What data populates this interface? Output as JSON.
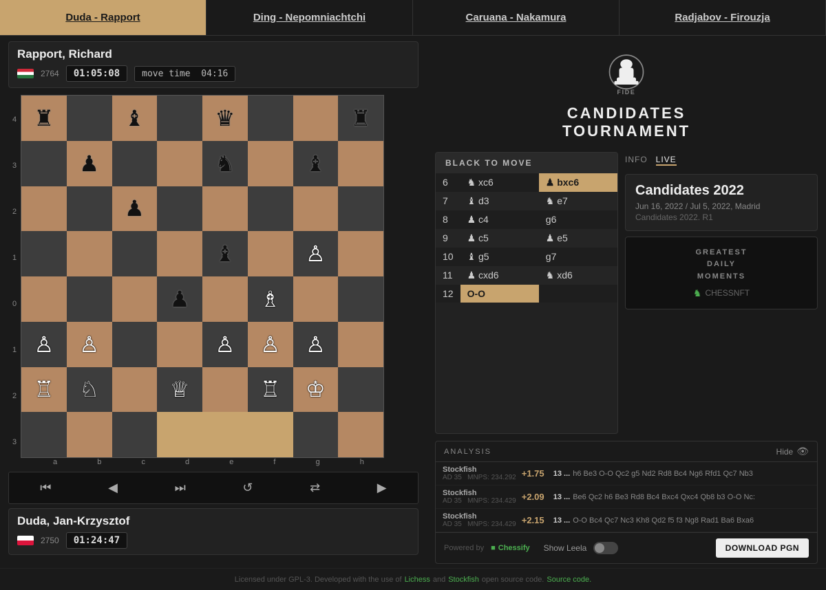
{
  "nav": {
    "items": [
      {
        "label": "Duda - Rapport",
        "active": true
      },
      {
        "label": "Ding - Nepomniachtchi",
        "active": false
      },
      {
        "label": "Caruana - Nakamura",
        "active": false
      },
      {
        "label": "Radjabov - Firouzja",
        "active": false
      }
    ]
  },
  "top_player": {
    "name": "Rapport, Richard",
    "rating": "2764",
    "clock": "01:05:08",
    "move_time_label": "move time",
    "move_time": "04:16",
    "flag": "hu"
  },
  "bottom_player": {
    "name": "Duda, Jan-Krzysztof",
    "rating": "2750",
    "clock": "01:24:47",
    "flag": "pl"
  },
  "controls": {
    "first": "⏮",
    "prev": "◀",
    "next_move": "⏭",
    "refresh": "↺",
    "flip": "⇄",
    "play": "▶"
  },
  "fide": {
    "title_line1": "CANDIDATES",
    "title_line2": "TOURNAMENT"
  },
  "moves_header": "BLACK TO MOVE",
  "moves": [
    {
      "num": "6",
      "white": "♞ xc6",
      "black": "♟ bxc6",
      "black_highlight": true
    },
    {
      "num": "7",
      "white": "♝ d3",
      "black": "♞ e7"
    },
    {
      "num": "8",
      "white": "♟ c4",
      "black": "g6"
    },
    {
      "num": "9",
      "white": "♟ c5",
      "black": "♟ e5"
    },
    {
      "num": "10",
      "white": "♝ g5",
      "black": "g7"
    },
    {
      "num": "11",
      "white": "♟ cxd6",
      "black": "♞ xd6"
    },
    {
      "num": "12",
      "white": "O-O",
      "black": "",
      "white_highlight": true
    }
  ],
  "info_tabs": [
    {
      "label": "INFO",
      "active": false
    },
    {
      "label": "LIVE",
      "active": true
    }
  ],
  "event": {
    "title": "Candidates 2022",
    "dates": "Jun 16, 2022 / Jul 5, 2022, Madrid",
    "round": "Candidates 2022. R1"
  },
  "greatest": {
    "line1": "GREATEST",
    "line2": "DAILY",
    "line3": "MOMENTS",
    "logo": "♞ CHESSNFT"
  },
  "analysis": {
    "header": "ANALYSIS",
    "hide_label": "Hide",
    "rows": [
      {
        "engine": "Stockfish",
        "ad": "AD 35",
        "mnps": "MNPS: 234.292",
        "eval": "+1.75",
        "move_num": "13 ...",
        "pv": "h6  Be3  O-O  Qc2  g5  Nd2  Rd8  Bc4  Ng6  Rfd1  Qc7  Nb3"
      },
      {
        "engine": "Stockfish",
        "ad": "AD 35",
        "mnps": "MNPS: 234.429",
        "eval": "+2.09",
        "move_num": "13 ...",
        "pv": "Be6  Qc2  h6  Be3  Rd8  Bc4  Bxc4  Qxc4  Qb8  b3  O-O  Nc:"
      },
      {
        "engine": "Stockfish",
        "ad": "AD 35",
        "mnps": "MNPS: 234.429",
        "eval": "+2.15",
        "move_num": "13 ...",
        "pv": "O-O  Bc4  Qc7  Nc3  Kh8  Qd2  f5  f3  Ng8  Rad1  Ba6  Bxa6"
      }
    ],
    "powered_by": "Powered by",
    "chessify": "Chessify",
    "show_leela": "Show Leela",
    "download_pgn": "DOWNLOAD PGN"
  },
  "footer": {
    "text": "Licensed under GPL-3. Developed with the use of",
    "lichess": "Lichess",
    "and": "and",
    "stockfish": "Stockfish",
    "open_source": "open source code.",
    "source_code": "Source code."
  },
  "board": {
    "ranks": [
      "4",
      "3",
      "2",
      "1",
      "0",
      "1",
      "2",
      "3"
    ],
    "files": [
      "a",
      "b",
      "c",
      "d",
      "e",
      "f",
      "g",
      "h"
    ],
    "squares": [
      {
        "row": 0,
        "col": 0,
        "piece": "♜",
        "color": "white"
      },
      {
        "row": 0,
        "col": 2,
        "piece": "♝",
        "color": "white"
      },
      {
        "row": 0,
        "col": 4,
        "piece": "♛",
        "color": "white"
      },
      {
        "row": 0,
        "col": 7,
        "piece": "♜",
        "color": "white"
      },
      {
        "row": 1,
        "col": 1,
        "piece": "♟",
        "color": "white"
      },
      {
        "row": 1,
        "col": 4,
        "piece": "♞",
        "color": "white"
      },
      {
        "row": 1,
        "col": 6,
        "piece": "♝",
        "color": "white"
      },
      {
        "row": 2,
        "col": 2,
        "piece": "♟",
        "color": "black"
      },
      {
        "row": 3,
        "col": 4,
        "piece": "♝",
        "color": "white"
      },
      {
        "row": 3,
        "col": 6,
        "piece": "♙",
        "color": "black"
      },
      {
        "row": 4,
        "col": 5,
        "piece": "♗",
        "color": "black"
      },
      {
        "row": 4,
        "col": 3,
        "piece": "♟",
        "color": "black"
      },
      {
        "row": 5,
        "col": 0,
        "piece": "♙",
        "color": "black"
      },
      {
        "row": 5,
        "col": 1,
        "piece": "♙",
        "color": "black"
      },
      {
        "row": 5,
        "col": 4,
        "piece": "♙",
        "color": "black"
      },
      {
        "row": 5,
        "col": 5,
        "piece": "♙",
        "color": "black"
      },
      {
        "row": 5,
        "col": 6,
        "piece": "♙",
        "color": "black"
      },
      {
        "row": 6,
        "col": 0,
        "piece": "♖",
        "color": "black"
      },
      {
        "row": 6,
        "col": 1,
        "piece": "♘",
        "color": "black"
      },
      {
        "row": 6,
        "col": 3,
        "piece": "♕",
        "color": "black"
      },
      {
        "row": 6,
        "col": 5,
        "piece": "♖",
        "color": "black"
      },
      {
        "row": 6,
        "col": 6,
        "piece": "♔",
        "color": "black"
      },
      {
        "row": 7,
        "col": 3,
        "piece": "",
        "color": ""
      },
      {
        "row": 7,
        "col": 4,
        "piece": "",
        "color": ""
      }
    ],
    "highlight_squares": [
      [
        7,
        3
      ],
      [
        7,
        4
      ],
      [
        7,
        5
      ]
    ]
  }
}
